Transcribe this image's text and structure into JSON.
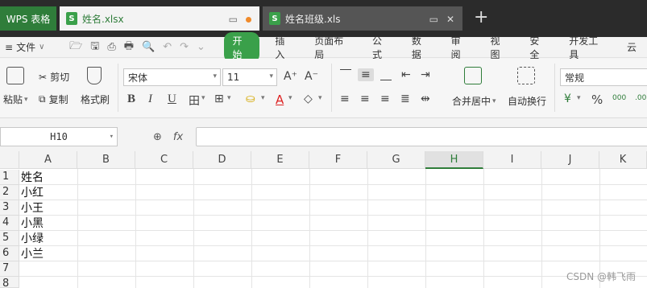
{
  "tabs": {
    "app_label": "WPS 表格",
    "active_file": "姓名.xlsx",
    "inactive_file": "姓名班级.xls",
    "file_icon_letter": "S",
    "new_tab": "+",
    "monitor_glyph": "▭",
    "close_glyph": "✕"
  },
  "menu": {
    "file_label": "文件",
    "file_chevron": "∨",
    "quick_icons": {
      "hamburger": "≡",
      "open": "🗁",
      "save": "🖫",
      "pdf": "⎙",
      "print": "🖶",
      "preview": "🔍",
      "undo": "↶",
      "redo": "↷",
      "more": "⌄"
    },
    "items": [
      "开始",
      "插入",
      "页面布局",
      "公式",
      "数据",
      "审阅",
      "视图",
      "安全",
      "开发工具",
      "云"
    ],
    "active_index": 0
  },
  "ribbon": {
    "paste_label": "粘贴",
    "cut_label": "剪切",
    "copy_label": "复制",
    "format_painter_label": "格式刷",
    "font_name": "宋体",
    "font_size": "11",
    "grow_font": "A⁺",
    "shrink_font": "A⁻",
    "bold": "B",
    "italic": "I",
    "underline": "U",
    "font_color_glyph": "A",
    "eraser_glyph": "◇",
    "border_glyph": "田",
    "fill_glyph": "⛀",
    "align_glyphs": {
      "top": "⎺",
      "middle": "≡",
      "bottom": "⎽",
      "outdent": "⇤",
      "indent": "⇥",
      "left": "≡",
      "center": "≡",
      "right": "≡",
      "justify": "≣",
      "distributed": "⇹"
    },
    "merge_center_label": "合并居中",
    "wrap_text_label": "自动换行",
    "number_format": "常规",
    "currency_glyph": "¥",
    "percent_glyph": "%",
    "thousands_glyph": "000",
    "decimal_glyph": ".00",
    "dropdown_glyph": "▾"
  },
  "formula_bar": {
    "name_box": "H10",
    "zoom_glyph": "⊕",
    "fx_label": "fx",
    "formula_value": ""
  },
  "sheet": {
    "columns": [
      "A",
      "B",
      "C",
      "D",
      "E",
      "F",
      "G",
      "H",
      "I",
      "J",
      "K"
    ],
    "selected_column": "H",
    "rows": [
      "1",
      "2",
      "3",
      "4",
      "5",
      "6",
      "7",
      "8"
    ],
    "column_a_values": [
      "姓名",
      "小红",
      "小王",
      "小黑",
      "小绿",
      "小兰"
    ]
  },
  "watermark": "CSDN @韩飞雨",
  "colors": {
    "accent": "#2f7d3a",
    "tab_bar": "#2b2b2b",
    "active_pill": "#3aa04a"
  }
}
